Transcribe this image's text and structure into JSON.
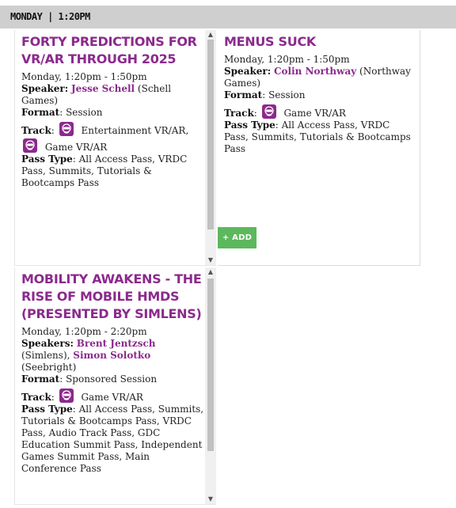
{
  "header": {
    "day_time": "MONDAY | 1:20PM"
  },
  "sessions": [
    {
      "title": "FORTY PREDICTIONS FOR VR/AR THROUGH 2025",
      "time": "Monday, 1:20pm - 1:50pm",
      "speaker_label": "Speaker:",
      "speaker_name": "Jesse Schell",
      "speaker_org": "(Schell Games)",
      "format_label": "Format",
      "format_value": ": Session",
      "track_label": "Track",
      "tracks": [
        "Entertainment VR/AR,",
        "Game VR/AR"
      ],
      "pass_label": "Pass Type",
      "pass_value": ": All Access Pass, VRDC Pass, Summits, Tutorials & Bootcamps Pass"
    },
    {
      "title": "MENUS SUCK",
      "time": "Monday, 1:20pm - 1:50pm",
      "speaker_label": "Speaker:",
      "speaker_name": "Colin Northway",
      "speaker_org": "(Northway Games)",
      "format_label": "Format",
      "format_value": ": Session",
      "track_label": "Track",
      "tracks": [
        "Game VR/AR"
      ],
      "pass_label": "Pass Type",
      "pass_value": ": All Access Pass, VRDC Pass, Summits, Tutorials & Bootcamps Pass"
    },
    {
      "title": "MOBILITY AWAKENS - THE RISE OF MOBILE HMDS (PRESENTED BY SIMLENS)",
      "time": "Monday, 1:20pm - 2:20pm",
      "speaker_label": "Speakers:",
      "speaker_name": "Brent Jentzsch",
      "speaker_org": "(Simlens),",
      "speaker2_name": "Simon Solotko",
      "speaker2_org": "(Seebright)",
      "format_label": "Format",
      "format_value": ": Sponsored Session",
      "track_label": "Track",
      "tracks": [
        "Game VR/AR"
      ],
      "pass_label": "Pass Type",
      "pass_value": ": All Access Pass, Summits, Tutorials & Bootcamps Pass, VRDC Pass, Audio Track Pass, GDC Education Summit Pass, Independent Games Summit Pass, Main Conference Pass"
    }
  ],
  "add_button": {
    "label": "+ ADD"
  },
  "scroll": {
    "up": "▲",
    "down": "▼"
  },
  "icons": {
    "track": "vr-headset-icon"
  },
  "colors": {
    "accent": "#8b2a8d",
    "add": "#5cb85c",
    "header_bg": "#cfcfcf"
  }
}
